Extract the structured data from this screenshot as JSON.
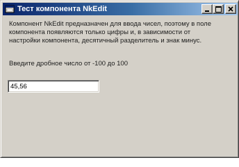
{
  "window": {
    "title": "Тест компонента NkEdit",
    "controls": {
      "minimize_icon": "minimize-icon",
      "maximize_icon": "maximize-icon",
      "close_icon": "close-icon"
    }
  },
  "content": {
    "description_line1": "Компонент NkEdit предназначен для ввода чисел, поэтому в поле",
    "description_line2": "компонента появляются только цифры и, в зависимости от",
    "description_line3": "настройки компонента, десятичный разделитель и знак минус.",
    "prompt": "Введите дробное число от -100 до 100",
    "input_value": "45,56"
  },
  "colors": {
    "title_bar_start": "#0a246a",
    "title_bar_end": "#a6caf0",
    "face": "#d4d0c8"
  }
}
